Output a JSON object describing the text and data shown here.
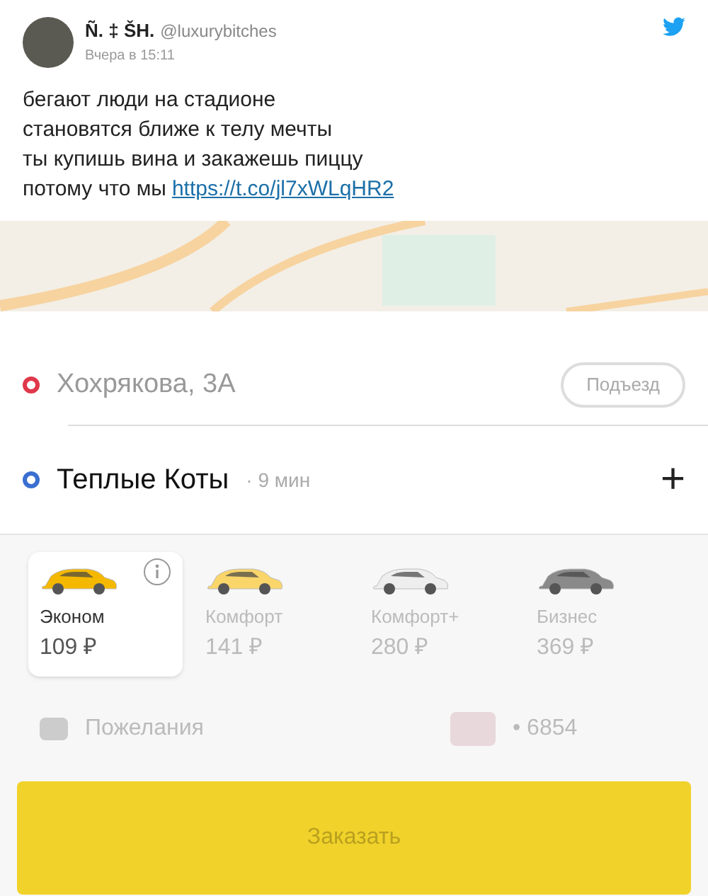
{
  "tweet": {
    "author_name": "Ñ. ‡ ŠH.",
    "handle": "@luxurybitches",
    "time": "Вчера в 15:11",
    "lines": [
      "бегают люди на стадионе",
      "становятся ближе к телу мечты",
      "ты купишь вина и закажешь пиццу"
    ],
    "last_line": "потому что мы",
    "link": "https://t.co/jl7xWLqHR2"
  },
  "app": {
    "from": {
      "address": "Хохрякова, 3А",
      "entrance": "Подъезд",
      "color": "#e0384b"
    },
    "to": {
      "address": "Теплые Коты",
      "eta": "· 9 мин",
      "add": "+",
      "color": "#3a6fd0"
    },
    "tariffs": [
      {
        "name": "Эконом",
        "price": "109 ₽",
        "selected": true,
        "color": "#f5b800"
      },
      {
        "name": "Комфорт",
        "price": "141 ₽",
        "selected": false,
        "color": "#f9d56a"
      },
      {
        "name": "Комфорт+",
        "price": "280 ₽",
        "selected": false,
        "color": "#eeeeee"
      },
      {
        "name": "Бизнес",
        "price": "369 ₽",
        "selected": false,
        "color": "#8a8a8a"
      }
    ],
    "wishes": "Пожелания",
    "card": "• 6854",
    "order_button": "Заказать"
  }
}
